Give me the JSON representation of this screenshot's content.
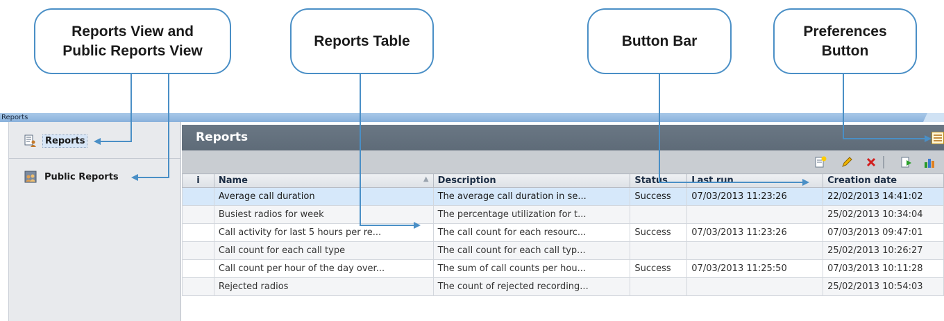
{
  "callouts": [
    {
      "text": "Reports View and\nPublic Reports View"
    },
    {
      "text": "Reports Table"
    },
    {
      "text": "Button Bar"
    },
    {
      "text": "Preferences\nButton"
    }
  ],
  "window": {
    "title": "Reports"
  },
  "sidebar": {
    "items": [
      {
        "label": "Reports",
        "icon": "reports-icon",
        "selected": true
      },
      {
        "label": "Public Reports",
        "icon": "public-reports-icon",
        "selected": false
      }
    ]
  },
  "main": {
    "title": "Reports",
    "preferences_icon": "preferences-icon",
    "toolbar": [
      "new-report-icon",
      "edit-icon",
      "delete-icon",
      "run-report-icon",
      "chart-icon"
    ]
  },
  "table": {
    "columns": {
      "info": "i",
      "name": "Name",
      "description": "Description",
      "status": "Status",
      "last_run": "Last run",
      "creation_date": "Creation date"
    },
    "rows": [
      {
        "name": "Average call duration",
        "description": "The average call duration in se...",
        "status": "Success",
        "last_run": "07/03/2013 11:23:26",
        "creation_date": "22/02/2013 14:41:02"
      },
      {
        "name": "Busiest radios for week",
        "description": "The percentage utilization for t...",
        "status": "",
        "last_run": "",
        "creation_date": "25/02/2013 10:34:04"
      },
      {
        "name": "Call activity for last 5 hours per re...",
        "description": "The call count for each resourc...",
        "status": "Success",
        "last_run": "07/03/2013 11:23:26",
        "creation_date": "07/03/2013 09:47:01"
      },
      {
        "name": "Call count for each call type",
        "description": "The call count for each call typ...",
        "status": "",
        "last_run": "",
        "creation_date": "25/02/2013 10:26:27"
      },
      {
        "name": "Call count per hour of the day over...",
        "description": "The sum of call counts per hou...",
        "status": "Success",
        "last_run": "07/03/2013 11:25:50",
        "creation_date": "07/03/2013 10:11:28"
      },
      {
        "name": "Rejected radios",
        "description": "The count of rejected recording...",
        "status": "",
        "last_run": "",
        "creation_date": "25/02/2013 10:54:03"
      }
    ]
  },
  "colors": {
    "callout_border": "#4a8fc6",
    "arrow": "#4a8fc6",
    "header_bg": "#636f7c",
    "selected_row": "#d6e8fa"
  }
}
